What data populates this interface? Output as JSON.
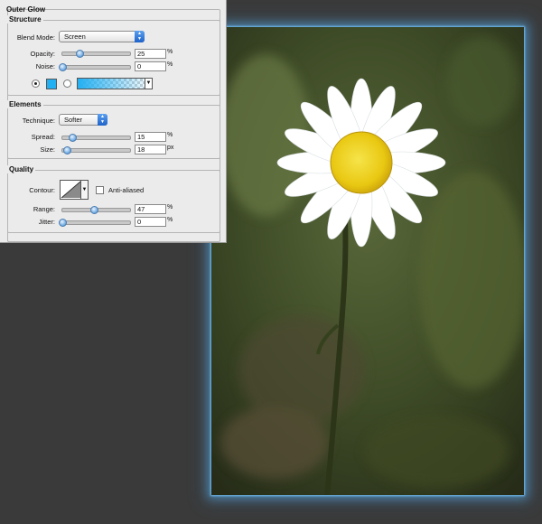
{
  "outer_glow": {
    "title": "Outer Glow",
    "structure": {
      "title": "Structure",
      "blend_mode_label": "Blend Mode:",
      "blend_mode_value": "Screen",
      "opacity_label": "Opacity:",
      "opacity_value": "25",
      "opacity_pct": 25,
      "opacity_unit": "%",
      "noise_label": "Noise:",
      "noise_value": "0",
      "noise_pct": 0,
      "noise_unit": "%",
      "glow_color": "#22b0f2"
    },
    "elements": {
      "title": "Elements",
      "technique_label": "Technique:",
      "technique_value": "Softer",
      "spread_label": "Spread:",
      "spread_value": "15",
      "spread_pct": 15,
      "spread_unit": "%",
      "size_label": "Size:",
      "size_value": "18",
      "size_fraction": 0.072,
      "size_unit": "px"
    },
    "quality": {
      "title": "Quality",
      "contour_label": "Contour:",
      "anti_aliased_label": "Anti-aliased",
      "anti_aliased_checked": false,
      "range_label": "Range:",
      "range_value": "47",
      "range_pct": 47,
      "range_unit": "%",
      "jitter_label": "Jitter:",
      "jitter_value": "0",
      "jitter_pct": 0,
      "jitter_unit": "%"
    }
  },
  "icons": {
    "select_arrows": "up-down-chevron",
    "dropdown": "chevron-down"
  }
}
